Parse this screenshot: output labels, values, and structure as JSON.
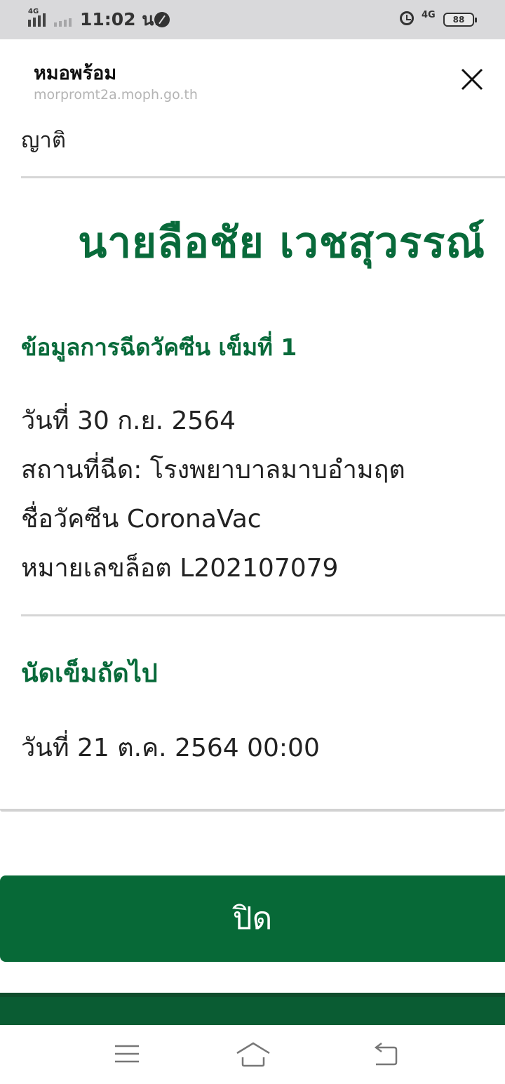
{
  "status_bar": {
    "network_label_1": "4G",
    "time": "11:02 น.",
    "network_label_2": "4G",
    "battery_level": "88"
  },
  "header": {
    "site_title": "หมอพร้อม",
    "site_url": "morpromt2a.moph.go.th"
  },
  "content": {
    "cut_text": "ญาติ",
    "person_name": "นายลือชัย เวชสุวรรณ์",
    "dose_heading": "ข้อมูลการฉีดวัคซีน เข็มที่ 1",
    "dose_date": "วันที่ 30 ก.ย. 2564",
    "dose_place": "สถานที่ฉีด: โรงพยาบาลมาบอำมฤต",
    "vaccine_name": "ชื่อวัคซีน CoronaVac",
    "lot_number": "หมายเลขล็อต L202107079",
    "next_heading": "นัดเข็มถัดไป",
    "next_date": "วันที่ 21 ต.ค. 2564 00:00"
  },
  "actions": {
    "close_label": "ปิด"
  },
  "icons": {
    "close": "close-x-icon",
    "menu": "menu-icon",
    "home": "home-icon",
    "back": "back-icon"
  },
  "colors": {
    "brand_green": "#086a3a",
    "button_green": "#076937"
  }
}
